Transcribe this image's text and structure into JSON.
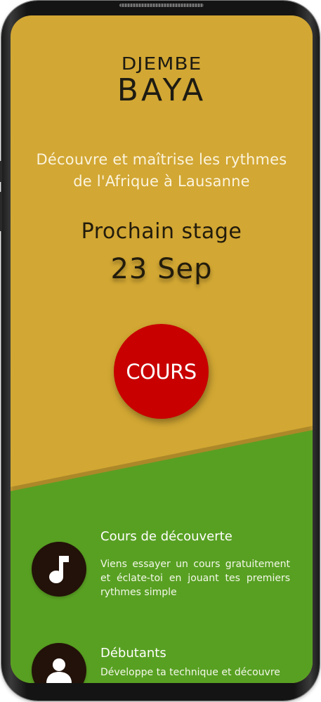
{
  "logo": {
    "line1": "DJEMBE",
    "line2": "BAYA"
  },
  "hero": {
    "tagline_line1": "Découvre et maîtrise les rythmes",
    "tagline_line2": "de l'Afrique à Lausanne",
    "next_label": "Prochain stage",
    "next_date": "23 Sep",
    "cta_label": "COURS"
  },
  "features": [
    {
      "icon": "music-note-icon",
      "title": "Cours de découverte",
      "description": "Viens essayer un cours gratuitement et éclate-toi en jouant tes premiers rythmes simple"
    },
    {
      "icon": "user-icon",
      "title": "Débutants",
      "description": "Développe ta technique et découvre"
    }
  ],
  "colors": {
    "top_background": "#d2a733",
    "bottom_background": "#58a022",
    "cta_background": "#c80000",
    "icon_circle": "#231209",
    "frame": "#141414"
  }
}
